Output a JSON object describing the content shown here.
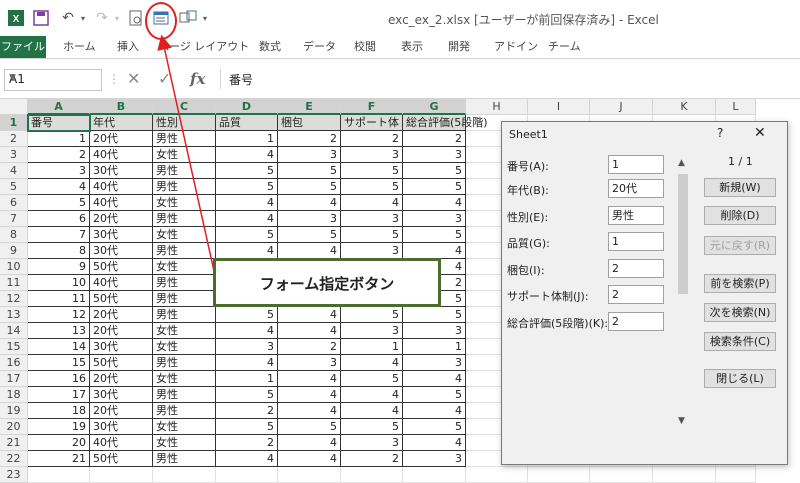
{
  "window": {
    "title": "exc_ex_2.xlsx [ユーザーが前回保存済み] - Excel"
  },
  "ribbon_tabs": [
    "ファイル",
    "ホーム",
    "挿入",
    "ページ レイアウト",
    "数式",
    "データ",
    "校閲",
    "表示",
    "開発",
    "アドイン",
    "チーム"
  ],
  "formula_bar": {
    "name_box": "A1",
    "formula": "番号",
    "fx_label": "fx"
  },
  "columns": [
    "A",
    "B",
    "C",
    "D",
    "E",
    "F",
    "G",
    "H",
    "I",
    "J",
    "K",
    "L"
  ],
  "headers": [
    "番号",
    "年代",
    "性別",
    "品質",
    "梱包",
    "サポート体制",
    "総合評価(5段階)"
  ],
  "header_display": {
    "support": "サポート体",
    "overall": "総合評価(5段階)"
  },
  "rows": [
    [
      "1",
      "20代",
      "男性",
      "1",
      "2",
      "2",
      "2"
    ],
    [
      "2",
      "40代",
      "女性",
      "4",
      "3",
      "3",
      "3"
    ],
    [
      "3",
      "30代",
      "男性",
      "5",
      "5",
      "5",
      "5"
    ],
    [
      "4",
      "40代",
      "男性",
      "5",
      "5",
      "5",
      "5"
    ],
    [
      "5",
      "40代",
      "女性",
      "4",
      "4",
      "4",
      "4"
    ],
    [
      "6",
      "20代",
      "男性",
      "4",
      "3",
      "3",
      "3"
    ],
    [
      "7",
      "30代",
      "女性",
      "5",
      "5",
      "5",
      "5"
    ],
    [
      "8",
      "30代",
      "男性",
      "4",
      "4",
      "3",
      "4"
    ],
    [
      "9",
      "50代",
      "女性",
      "",
      "",
      "",
      "4"
    ],
    [
      "10",
      "40代",
      "男性",
      "",
      "",
      "",
      "2"
    ],
    [
      "11",
      "50代",
      "男性",
      "",
      "",
      "",
      "5"
    ],
    [
      "12",
      "20代",
      "男性",
      "5",
      "4",
      "5",
      "5"
    ],
    [
      "13",
      "20代",
      "女性",
      "4",
      "4",
      "3",
      "3"
    ],
    [
      "14",
      "30代",
      "女性",
      "3",
      "2",
      "1",
      "1"
    ],
    [
      "15",
      "50代",
      "男性",
      "4",
      "3",
      "4",
      "3"
    ],
    [
      "16",
      "20代",
      "女性",
      "1",
      "4",
      "5",
      "4"
    ],
    [
      "17",
      "30代",
      "男性",
      "5",
      "4",
      "4",
      "5"
    ],
    [
      "18",
      "20代",
      "男性",
      "2",
      "4",
      "4",
      "4"
    ],
    [
      "19",
      "30代",
      "女性",
      "5",
      "5",
      "5",
      "5"
    ],
    [
      "20",
      "40代",
      "女性",
      "2",
      "4",
      "3",
      "4"
    ],
    [
      "21",
      "50代",
      "男性",
      "4",
      "4",
      "2",
      "3"
    ]
  ],
  "row_numbers": [
    "1",
    "2",
    "3",
    "4",
    "5",
    "6",
    "7",
    "8",
    "9",
    "10",
    "11",
    "12",
    "13",
    "14",
    "15",
    "16",
    "17",
    "18",
    "19",
    "20",
    "21",
    "22",
    "23"
  ],
  "dialog": {
    "title": "Sheet1",
    "help": "?",
    "close": "✕",
    "record_counter": "1 / 1",
    "fields": [
      {
        "label": "番号(A):",
        "value": "1"
      },
      {
        "label": "年代(B):",
        "value": "20代"
      },
      {
        "label": "性別(E):",
        "value": "男性"
      },
      {
        "label": "品質(G):",
        "value": "1"
      },
      {
        "label": "梱包(I):",
        "value": "2"
      },
      {
        "label": "サポート体制(J):",
        "value": "2"
      },
      {
        "label": "総合評価(5段階)(K):",
        "value": "2"
      }
    ],
    "buttons": [
      {
        "label": "新規(W)",
        "enabled": true
      },
      {
        "label": "削除(D)",
        "enabled": true
      },
      {
        "label": "元に戻す(R)",
        "enabled": false
      },
      {
        "label": "前を検索(P)",
        "enabled": true
      },
      {
        "label": "次を検索(N)",
        "enabled": true
      },
      {
        "label": "検索条件(C)",
        "enabled": true
      },
      {
        "label": "閉じる(L)",
        "enabled": true
      }
    ]
  },
  "annotation": {
    "label": "フォーム指定ボタン"
  },
  "colors": {
    "excel_green": "#217346",
    "annotation_red": "#e02020",
    "callout_border": "#4d6b2f"
  }
}
